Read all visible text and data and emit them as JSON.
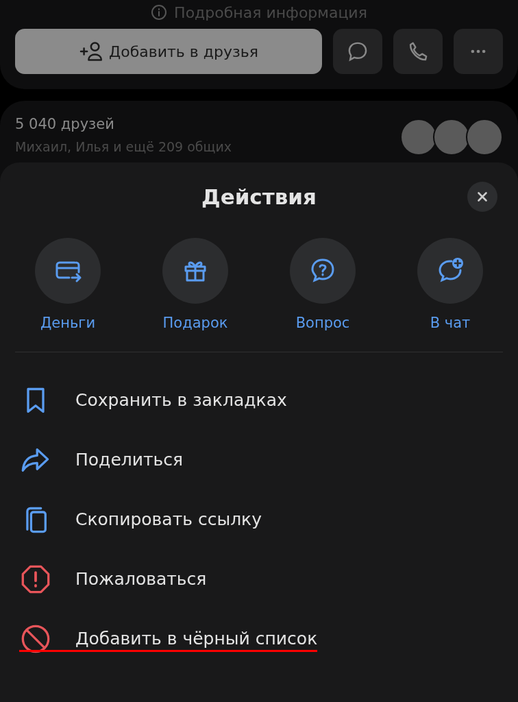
{
  "profile": {
    "info_link": "Подробная информация",
    "add_friend_button": "Добавить в друзья"
  },
  "friends": {
    "count": "5 040 друзей",
    "mutual": "Михаил, Илья и ещё 209 общих"
  },
  "sheet": {
    "title": "Действия",
    "quick_actions": [
      {
        "kind": "money",
        "label": "Деньги"
      },
      {
        "kind": "gift",
        "label": "Подарок"
      },
      {
        "kind": "question",
        "label": "Вопрос"
      },
      {
        "kind": "chat",
        "label": "В чат"
      }
    ],
    "items": [
      {
        "kind": "bookmark",
        "label": "Сохранить в закладках",
        "underlined": false
      },
      {
        "kind": "share",
        "label": "Поделиться",
        "underlined": false
      },
      {
        "kind": "copy",
        "label": "Скопировать ссылку",
        "underlined": false
      },
      {
        "kind": "report",
        "label": "Пожаловаться",
        "underlined": false
      },
      {
        "kind": "block",
        "label": "Добавить в чёрный список",
        "underlined": true
      }
    ]
  }
}
